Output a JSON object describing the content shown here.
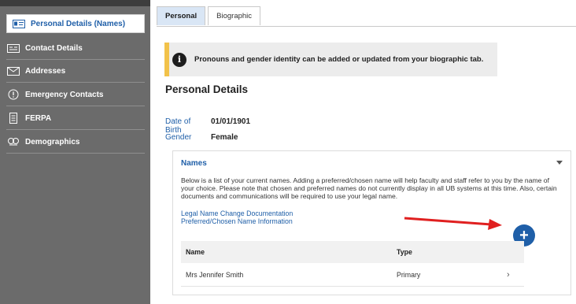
{
  "sidebar": {
    "items": [
      {
        "label": "Personal Details (Names)",
        "icon": "id-card-icon",
        "active": true
      },
      {
        "label": "Contact Details",
        "icon": "contact-card-icon"
      },
      {
        "label": "Addresses",
        "icon": "envelope-icon"
      },
      {
        "label": "Emergency Contacts",
        "icon": "alert-circle-icon"
      },
      {
        "label": "FERPA",
        "icon": "document-icon"
      },
      {
        "label": "Demographics",
        "icon": "people-icon"
      }
    ]
  },
  "tabs": [
    {
      "label": "Personal",
      "active": true
    },
    {
      "label": "Biographic"
    }
  ],
  "alert": {
    "icon": "info-icon",
    "text": "Pronouns and gender identity can be added or updated from your biographic tab."
  },
  "personal": {
    "heading": "Personal Details",
    "dob_label": "Date of Birth",
    "dob_value": "01/01/1901",
    "gender_label": "Gender",
    "gender_value": "Female"
  },
  "names": {
    "title": "Names",
    "description": "Below is a list of your current names. Adding a preferred/chosen name will help faculty and staff refer to you by the name of your choice. Please note that chosen and preferred names do not currently display in all UB systems at this time. Also, certain documents and communications will be required to use your legal name.",
    "link1": "Legal Name Change Documentation",
    "link2": "Preferred/Chosen Name Information",
    "add_label": "+",
    "col_name": "Name",
    "col_type": "Type",
    "rows": [
      {
        "name": "Mrs Jennifer Smith",
        "type": "Primary",
        "chevron": "›"
      }
    ]
  },
  "colors": {
    "accent": "#1f5fa8",
    "sidebar": "#6b6b6b",
    "alert_bar": "#f2c24a",
    "arrow": "#e02020"
  }
}
